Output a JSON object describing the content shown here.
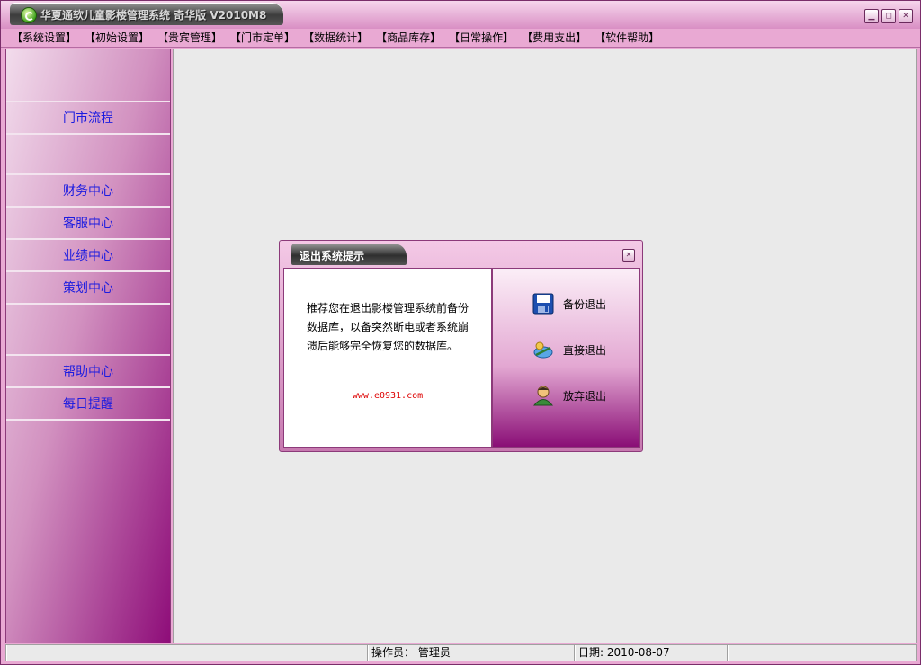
{
  "window": {
    "title": "华夏通软儿童影楼管理系统 奇华版 V2010M8"
  },
  "menu": [
    "【系统设置】",
    "【初始设置】",
    "【贵宾管理】",
    "【门市定单】",
    "【数据统计】",
    "【商品库存】",
    "【日常操作】",
    "【费用支出】",
    "【软件帮助】"
  ],
  "sidebar": {
    "items": [
      "门市流程",
      "财务中心",
      "客服中心",
      "业绩中心",
      "策划中心",
      "帮助中心",
      "每日提醒"
    ]
  },
  "dialog": {
    "title": "退出系统提示",
    "message": "推荐您在退出影楼管理系统前备份数据库，以备突然断电或者系统崩溃后能够完全恢复您的数据库。",
    "url": "www.e0931.com",
    "options": {
      "backup": "备份退出",
      "direct": "直接退出",
      "abandon": "放弃退出"
    }
  },
  "status": {
    "operator": "操作员： 管理员",
    "date": "日期:  2010-08-07"
  },
  "colors": {
    "theme": "#e9a9d3",
    "sidebar_dark": "#8e0d79",
    "link_blue": "#1c1ce0",
    "url_red": "#dd0000"
  }
}
